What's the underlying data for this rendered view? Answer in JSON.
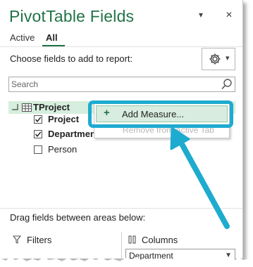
{
  "pane": {
    "title": "PivotTable Fields",
    "dropdown_glyph": "▾",
    "close_glyph": "✕"
  },
  "tabs": [
    {
      "label": "Active",
      "selected": false
    },
    {
      "label": "All",
      "selected": true
    }
  ],
  "choose_label": "Choose fields to add to report:",
  "tools_button": {
    "icon": "gear-icon",
    "caret": "▾"
  },
  "search": {
    "placeholder": "Search",
    "icon": "search-icon"
  },
  "field_list": {
    "table": {
      "name": "TProject",
      "expanded": true,
      "icon": "table-icon"
    },
    "fields": [
      {
        "name": "Project",
        "checked": true,
        "bold": true
      },
      {
        "name": "Department",
        "checked": true,
        "bold": true
      },
      {
        "name": "Person",
        "checked": false,
        "bold": false
      }
    ]
  },
  "context_menu": {
    "items": [
      {
        "label": "Add Measure...",
        "icon": "plus-icon",
        "enabled": true,
        "highlighted": true
      },
      {
        "label": "Remove from Active Tab",
        "enabled": false
      }
    ]
  },
  "areas": {
    "drag_label": "Drag fields between areas below:",
    "filters_label": "Filters",
    "columns_label": "Columns",
    "columns_value": "Department"
  },
  "colors": {
    "accent": "#217346",
    "selection": "#d6eedd",
    "callout": "#1eabd0"
  }
}
